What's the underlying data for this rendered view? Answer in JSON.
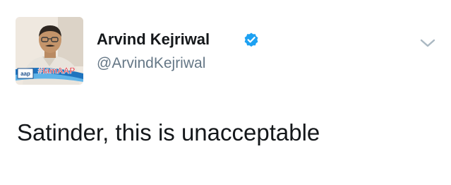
{
  "author": {
    "name": "Arvind Kejriwal",
    "handle": "@ArvindKejriwal",
    "verified": true,
    "avatar": {
      "badge_left": "aap",
      "badge_right": "#IamAAP"
    }
  },
  "tweet": {
    "text": "Satinder, this is unacceptable"
  },
  "icons": {
    "verified": "verified-badge-icon",
    "menu": "chevron-down-icon"
  },
  "colors": {
    "text": "#14171a",
    "secondary": "#657786",
    "verified": "#1da1f2",
    "chevron": "#aab8c2"
  }
}
